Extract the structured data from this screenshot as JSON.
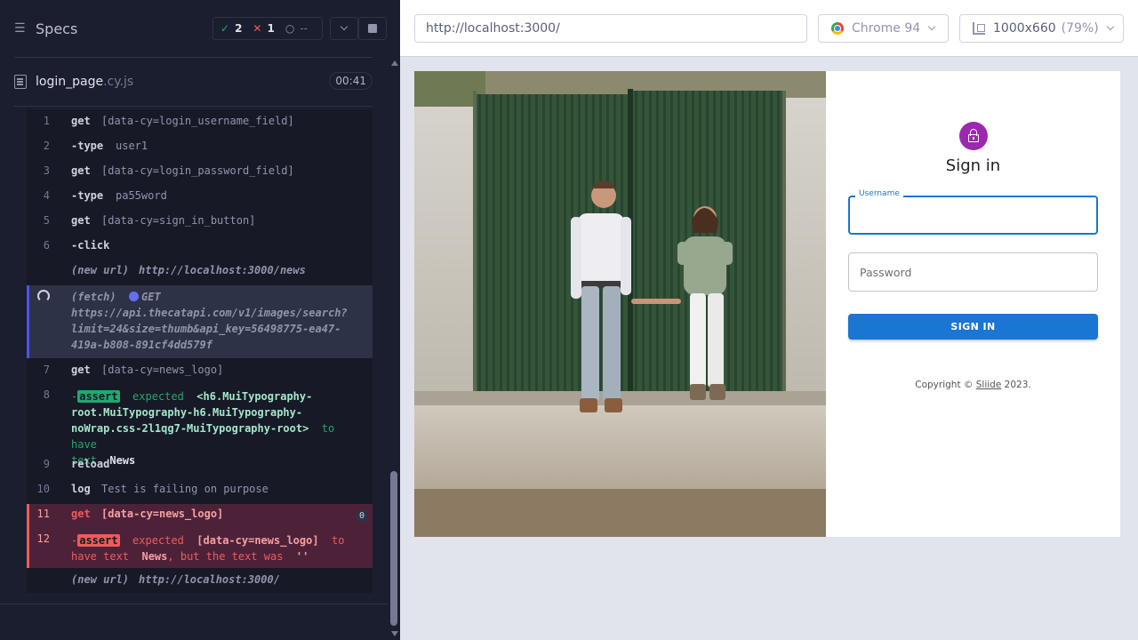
{
  "reporter": {
    "title": "Specs",
    "stats": {
      "passed": "2",
      "failed": "1",
      "pending": "--"
    },
    "file": {
      "name": "login_page",
      "ext": ".cy.js",
      "duration": "00:41"
    }
  },
  "commands": [
    {
      "num": "1",
      "name": "get",
      "message": "[data-cy=login_username_field]"
    },
    {
      "num": "2",
      "name": "-type",
      "message": "user1"
    },
    {
      "num": "3",
      "name": "get",
      "message": "[data-cy=login_password_field]"
    },
    {
      "num": "4",
      "name": "-type",
      "message": "pa55word"
    },
    {
      "num": "5",
      "name": "get",
      "message": "[data-cy=sign_in_button]"
    },
    {
      "num": "6",
      "name": "-click",
      "message": ""
    }
  ],
  "new_url_1": {
    "label": "(new url)",
    "url": "http://localhost:3000/news"
  },
  "fetch": {
    "label": "(fetch)",
    "method": "GET",
    "url_line1": "https://api.thecatapi.com/v1/images/search?",
    "url_line2": "limit=24&size=thumb&api_key=56498775-ea47-",
    "url_line3": "419a-b808-891cf4dd579f"
  },
  "cmd7": {
    "num": "7",
    "name": "get",
    "message": "[data-cy=news_logo]"
  },
  "cmd8": {
    "num": "8",
    "dash": "-",
    "badge": "assert",
    "expected": "expected",
    "subject_l1": "<h6.MuiTypography-",
    "subject_l2": "root.MuiTypography-h6.MuiTypography-",
    "subject_l3": "noWrap.css-2l1qg7-MuiTypography-root>",
    "to_have": "to have",
    "text_word": "text",
    "value": "News"
  },
  "cmd9": {
    "num": "9",
    "name": "reload",
    "message": ""
  },
  "cmd10": {
    "num": "10",
    "name": "log",
    "message": "Test is failing on purpose"
  },
  "cmd11": {
    "num": "11",
    "name": "get",
    "message": "[data-cy=news_logo]",
    "count": "0"
  },
  "cmd12": {
    "num": "12",
    "dash": "-",
    "badge": "assert",
    "expected": "expected",
    "subject": "[data-cy=news_logo]",
    "to": "to",
    "have_text": "have text",
    "value": "News",
    "but": ", but the text was",
    "actual": "''"
  },
  "new_url_2": {
    "label": "(new url)",
    "url": "http://localhost:3000/"
  },
  "aut": {
    "url": "http://localhost:3000/",
    "browser": "Chrome 94",
    "viewport": "1000x660",
    "scale": "(79%)"
  },
  "signin": {
    "title": "Sign in",
    "username_label": "Username",
    "password_placeholder": "Password",
    "button": "SIGN IN",
    "copyright_prefix": "Copyright ©",
    "copyright_link": "Sliide",
    "copyright_suffix": "2023."
  },
  "colors": {
    "pass": "#1fa971",
    "fail": "#f15a5a",
    "primary": "#1976d2",
    "avatar": "#9c27b0"
  }
}
